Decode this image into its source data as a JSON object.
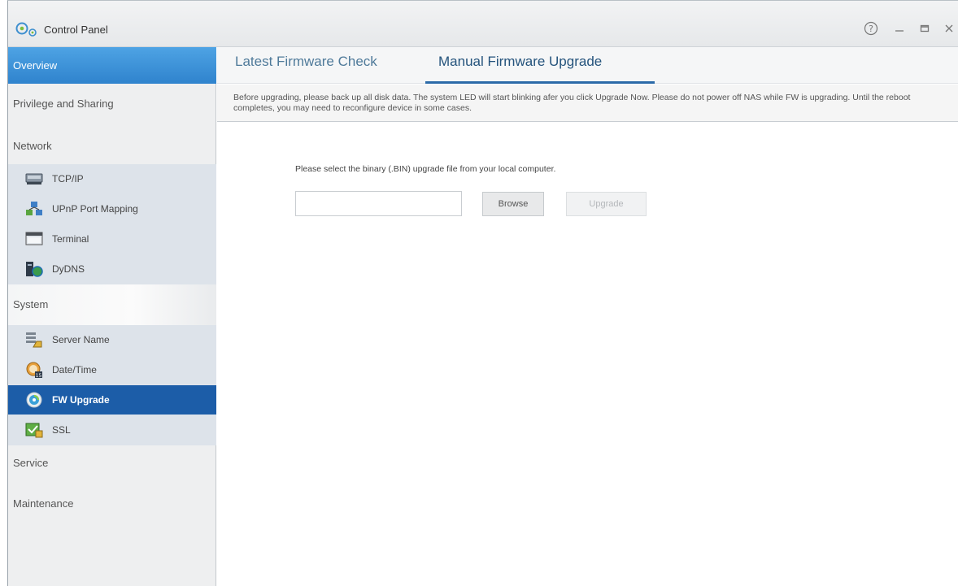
{
  "window": {
    "title": "Control Panel",
    "controls": {
      "help": "?",
      "minimize": "—",
      "maximize": "▫",
      "close": "×"
    }
  },
  "sidebar": {
    "overview": "Overview",
    "privilege": "Privilege and Sharing",
    "network": {
      "label": "Network",
      "items": [
        {
          "label": "TCP/IP",
          "icon": "network-card-icon"
        },
        {
          "label": "UPnP Port Mapping",
          "icon": "upnp-icon"
        },
        {
          "label": "Terminal",
          "icon": "terminal-icon"
        },
        {
          "label": "DyDNS",
          "icon": "dydns-icon"
        }
      ]
    },
    "system": {
      "label": "System",
      "items": [
        {
          "label": "Server Name",
          "icon": "server-name-icon"
        },
        {
          "label": "Date/Time",
          "icon": "date-time-icon"
        },
        {
          "label": "FW Upgrade",
          "icon": "fw-upgrade-icon",
          "active": true
        },
        {
          "label": "SSL",
          "icon": "ssl-icon"
        }
      ]
    },
    "service": "Service",
    "maintenance": "Maintenance"
  },
  "tabs": {
    "latest": "Latest Firmware Check",
    "manual": "Manual Firmware Upgrade",
    "selected": "manual"
  },
  "notice": "Before upgrading, please back up all disk data. The system LED will start blinking afer you click Upgrade Now. Please do not power off NAS while FW is upgrading. Until the reboot completes, you may need to reconfigure device in some cases.",
  "upload": {
    "prompt": "Please select the binary (.BIN) upgrade file from your local computer.",
    "file_value": "",
    "browse_label": "Browse",
    "upgrade_label": "Upgrade"
  },
  "colors": {
    "accent": "#2f83cd",
    "active_item": "#1c5da8",
    "tab_underline": "#2b6aa8"
  }
}
